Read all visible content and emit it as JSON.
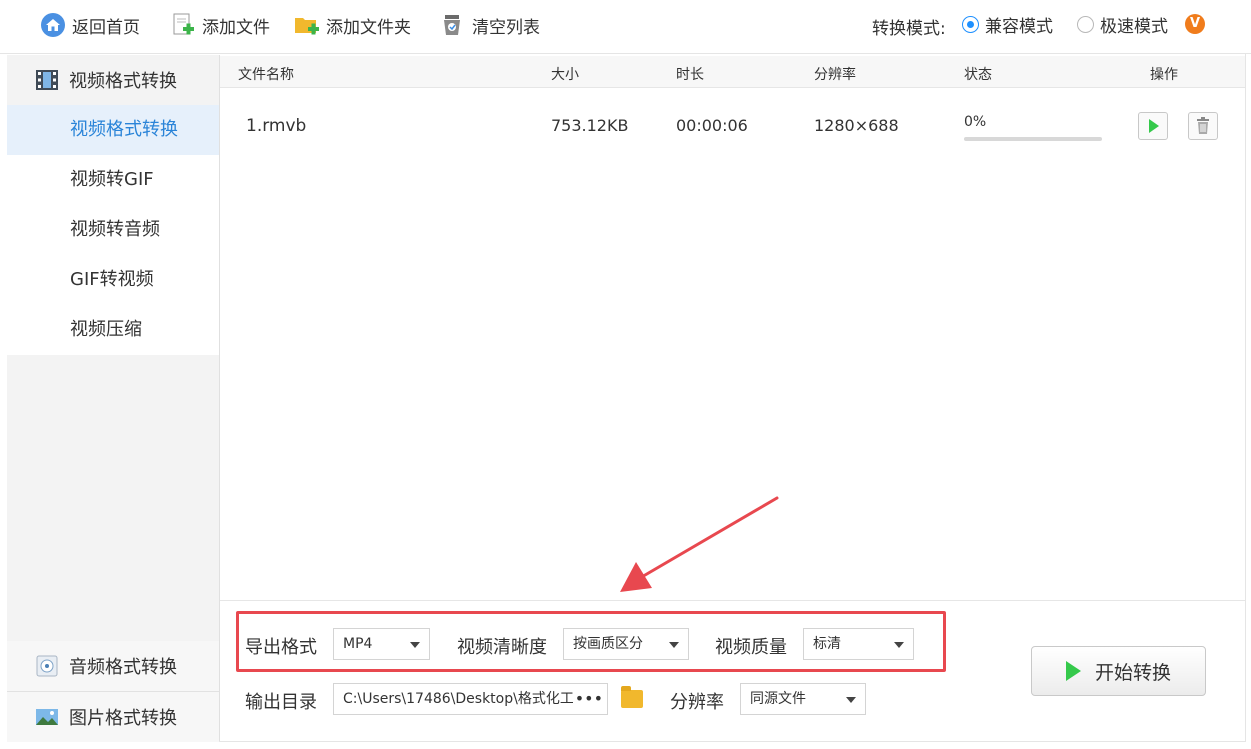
{
  "toolbar": {
    "home_label": "返回首页",
    "add_file_label": "添加文件",
    "add_folder_label": "添加文件夹",
    "clear_list_label": "清空列表",
    "mode_label": "转换模式:",
    "mode_options": [
      {
        "label": "兼容模式",
        "selected": true
      },
      {
        "label": "极速模式",
        "selected": false
      }
    ],
    "vip_badge": "V"
  },
  "sidebar": {
    "video_section": "视频格式转换",
    "video_items": [
      {
        "label": "视频格式转换",
        "active": true
      },
      {
        "label": "视频转GIF",
        "active": false
      },
      {
        "label": "视频转音频",
        "active": false
      },
      {
        "label": "GIF转视频",
        "active": false
      },
      {
        "label": "视频压缩",
        "active": false
      }
    ],
    "audio_section": "音频格式转换",
    "image_section": "图片格式转换"
  },
  "table": {
    "headers": {
      "name": "文件名称",
      "size": "大小",
      "duration": "时长",
      "resolution": "分辨率",
      "status": "状态",
      "actions": "操作"
    },
    "rows": [
      {
        "name": "1.rmvb",
        "size": "753.12KB",
        "duration": "00:00:06",
        "resolution": "1280×688",
        "progress_text": "0%",
        "progress": 0
      }
    ]
  },
  "settings": {
    "export_format_label": "导出格式",
    "export_format_value": "MP4",
    "clarity_label": "视频清晰度",
    "clarity_value": "按画质区分",
    "quality_label": "视频质量",
    "quality_value": "标清",
    "output_dir_label": "输出目录",
    "output_dir_value": "C:\\Users\\17486\\Desktop\\格式化工",
    "output_dir_more": "•••",
    "resolution_label": "分辨率",
    "resolution_value": "同源文件"
  },
  "start_button_label": "开始转换",
  "colors": {
    "accent": "#2a84d8",
    "radio": "#1e90ff",
    "highlight": "#e8484f",
    "play_green": "#35c94b",
    "vip_orange": "#f07c1c"
  }
}
